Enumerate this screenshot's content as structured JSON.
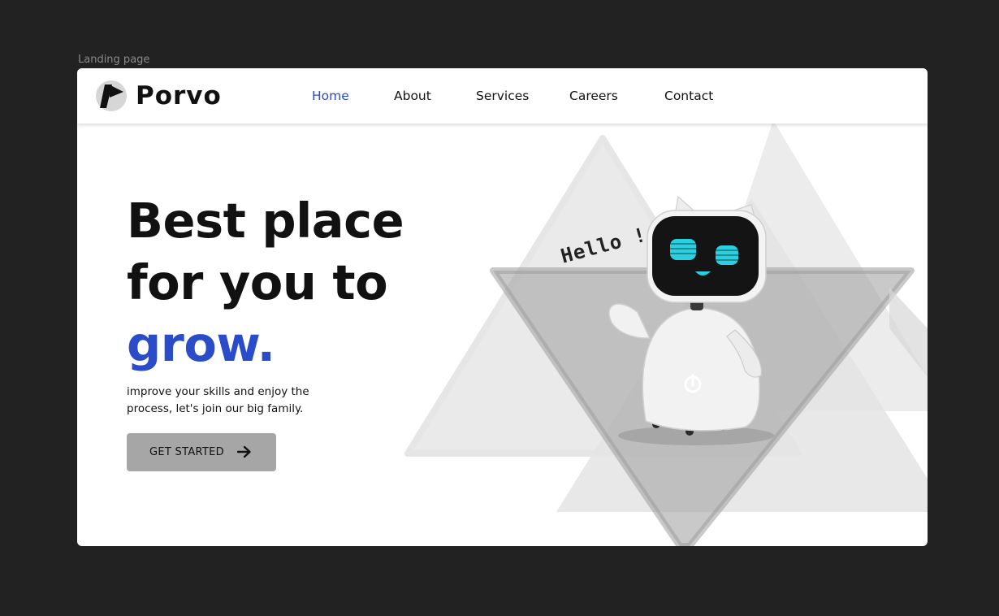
{
  "canvas": {
    "frame_label": "Landing page"
  },
  "brand": {
    "name": "Porvo"
  },
  "nav": {
    "items": [
      {
        "label": "Home",
        "active": true
      },
      {
        "label": "About",
        "active": false
      },
      {
        "label": "Services",
        "active": false
      },
      {
        "label": "Careers",
        "active": false
      },
      {
        "label": "Contact",
        "active": false
      }
    ]
  },
  "hero": {
    "title_line1": "Best place",
    "title_line2": "for you to",
    "title_accent": "grow.",
    "subtitle": "improve your skills and enjoy the process, let's join our big family.",
    "cta_label": "GET STARTED",
    "cta_icon": "arrow-right-icon"
  },
  "illustration": {
    "speech_text": "Hello !",
    "character": "robot"
  },
  "colors": {
    "accent": "#2a4cc8",
    "page_background": "#222222",
    "frame_background": "#ffffff",
    "button_background": "#a6a6a6",
    "robot_eyes": "#2ad0e0"
  }
}
